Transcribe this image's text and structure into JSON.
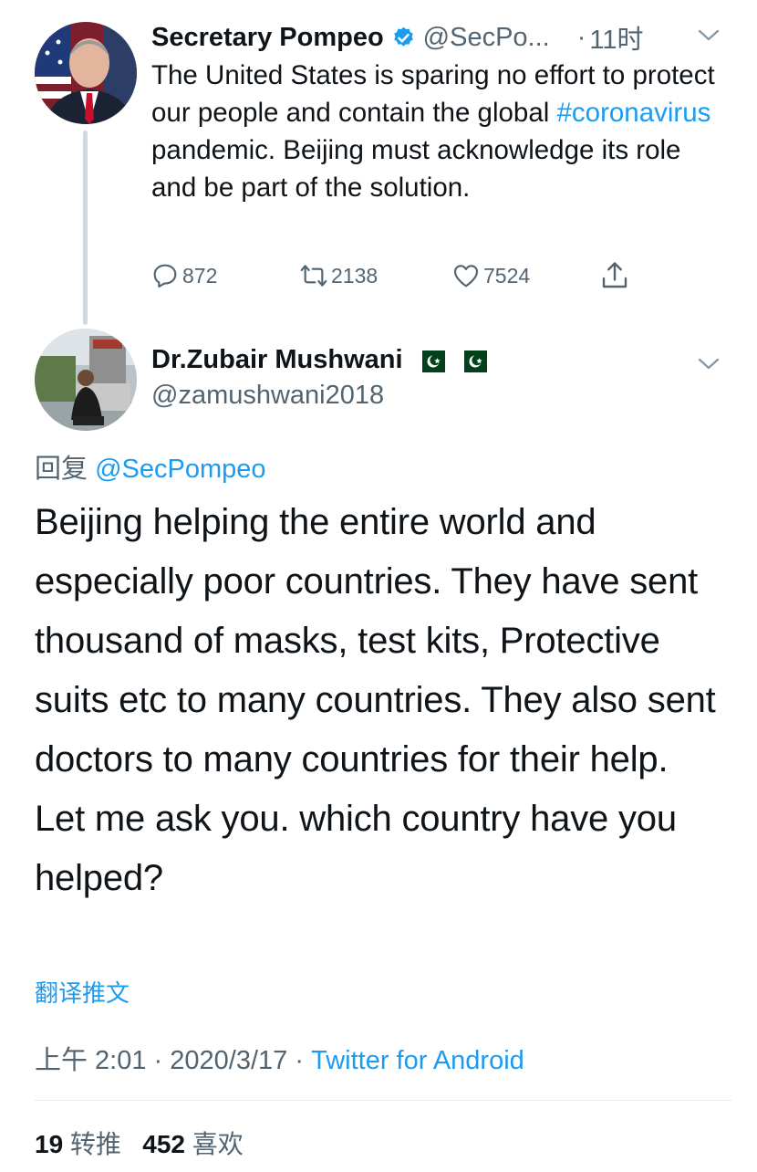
{
  "parent_tweet": {
    "author_name": "Secretary Pompeo",
    "handle": "@SecPo...",
    "dot": "·",
    "time": "11时",
    "text_before": "The United States is sparing no effort to protect our people and contain the global ",
    "hashtag": "#coronavirus",
    "text_after": " pandemic. Beijing must acknowledge its role and be part of the solution.",
    "replies": "872",
    "retweets": "2138",
    "likes": "7524"
  },
  "reply_tweet": {
    "author_name": "Dr.Zubair Mushwani",
    "handle": "@zamushwani2018",
    "reply_prefix": "回复 ",
    "reply_to": "@SecPompeo",
    "text": "Beijing helping the entire world and especially poor countries. They have sent thousand of masks, test kits, Protective suits etc to many countries. They also sent doctors to many countries for their help. Let me ask you. which country have you helped?",
    "translate_label": "翻译推文",
    "time": "上午 2:01",
    "sep1": " · ",
    "date": "2020/3/17",
    "sep2": " · ",
    "source": "Twitter for Android",
    "retweet_count": "19",
    "retweet_label": " 转推",
    "like_count": "452",
    "like_label": " 喜欢"
  },
  "colors": {
    "link": "#1d9bf0",
    "secondary_text": "#536471",
    "verified_badge": "#1d9bf0",
    "pakistan_flag_green": "#01411c"
  },
  "icons": [
    "verified-badge-icon",
    "chevron-down-icon",
    "reply-icon",
    "retweet-icon",
    "like-icon",
    "share-icon",
    "pakistan-flag-icon"
  ]
}
